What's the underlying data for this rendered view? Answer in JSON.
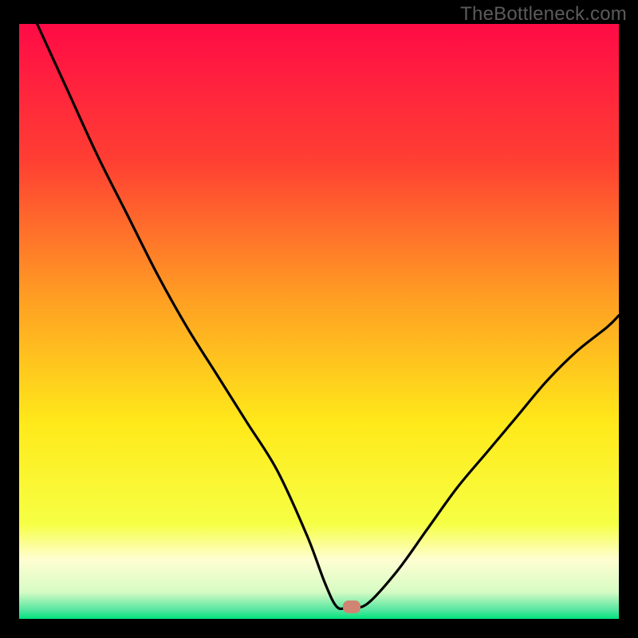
{
  "watermark": "TheBottleneck.com",
  "chart_data": {
    "type": "line",
    "title": "",
    "xlabel": "",
    "ylabel": "",
    "xlim": [
      0,
      100
    ],
    "ylim": [
      0,
      100
    ],
    "grid": false,
    "series": [
      {
        "name": "bottleneck-curve",
        "x": [
          3,
          8,
          13,
          18,
          23,
          28,
          33,
          38,
          43,
          48,
          51,
          53,
          55,
          58,
          63,
          68,
          73,
          78,
          83,
          88,
          93,
          98,
          100
        ],
        "y": [
          100,
          89,
          78,
          68,
          58,
          49,
          41,
          33,
          25,
          14,
          6,
          2,
          2,
          2.5,
          8,
          15,
          22,
          28,
          34,
          40,
          45,
          49,
          51
        ]
      }
    ],
    "marker": {
      "x": 55.5,
      "y": 2,
      "color": "#d08472"
    },
    "gradient_stops": [
      {
        "pos": 0.0,
        "color": "#ff0b46"
      },
      {
        "pos": 0.23,
        "color": "#ff3f33"
      },
      {
        "pos": 0.46,
        "color": "#ff9e23"
      },
      {
        "pos": 0.67,
        "color": "#ffe91a"
      },
      {
        "pos": 0.84,
        "color": "#f6ff44"
      },
      {
        "pos": 0.9,
        "color": "#fffed2"
      },
      {
        "pos": 0.955,
        "color": "#d6fbc4"
      },
      {
        "pos": 0.985,
        "color": "#55e6a0"
      },
      {
        "pos": 1.0,
        "color": "#00e37c"
      }
    ]
  }
}
